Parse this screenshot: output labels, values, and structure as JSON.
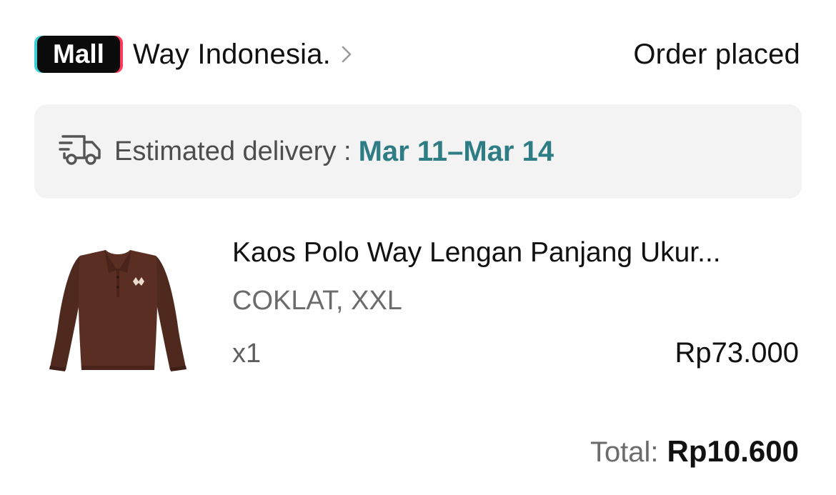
{
  "header": {
    "badge_label": "Mall",
    "shop_name": "Way Indonesia.",
    "status": "Order placed"
  },
  "delivery": {
    "icon": "delivery-truck-icon",
    "label": "Estimated delivery :",
    "dates": "Mar 11–Mar 14"
  },
  "product": {
    "image": "brown-long-sleeve-polo-image",
    "title": "Kaos Polo Way Lengan Panjang Ukur...",
    "variant": "COKLAT, XXL",
    "quantity": "x1",
    "price": "Rp73.000"
  },
  "summary": {
    "total_label": "Total:",
    "total_value": "Rp10.600"
  },
  "colors": {
    "accent_teal": "#2f7d84",
    "badge_black": "#0b0b0b",
    "badge_cyan": "#3ad0d8",
    "badge_pink": "#ff3b5c",
    "delivery_bg": "#f3f3f4",
    "shirt_brown": "#5a2e22"
  }
}
